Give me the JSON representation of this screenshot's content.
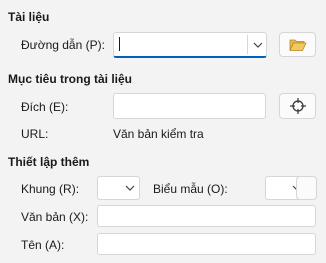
{
  "sections": {
    "document": "Tài liệu",
    "target": "Mục tiêu trong tài liệu",
    "settings": "Thiết lập thêm"
  },
  "document": {
    "path_label": "Đường dẫn (P):",
    "path_value": ""
  },
  "target": {
    "dest_label": "Đích (E):",
    "dest_value": "",
    "url_label": "URL:",
    "url_value": "Văn bản kiểm tra"
  },
  "settings": {
    "frame_label": "Khung (R):",
    "frame_value": "",
    "form_label": "Biểu mẫu (O):",
    "form_value": "",
    "text_label": "Văn bản (X):",
    "text_value": "",
    "name_label": "Tên (A):",
    "name_value": ""
  },
  "icons": {
    "open_file": "folder-open-icon",
    "target": "crosshair-icon",
    "dropdown": "chevron-down-icon"
  },
  "colors": {
    "accent": "#005fb8",
    "folder": "#d9a43a"
  }
}
